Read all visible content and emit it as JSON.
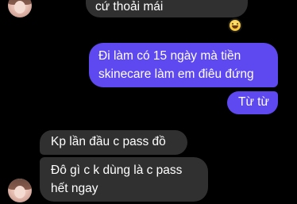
{
  "messages": {
    "top_incoming": "cứ thoải mái",
    "outgoing_1": [
      "Đi làm có 15 ngày mà tiền",
      "skinecare làm em điêu đứng"
    ],
    "outgoing_2": "Từ từ",
    "incoming_1": "Kp lần đầu c pass đồ",
    "incoming_2": [
      "Đô gì c k dùng là c pass",
      "hết ngay"
    ]
  },
  "reaction": {
    "icon": "grinning-face-emoji"
  },
  "colors": {
    "background": "#000000",
    "incoming_bubble": "#303030",
    "outgoing_bubble": "#5e48f0",
    "text": "#ffffff"
  }
}
